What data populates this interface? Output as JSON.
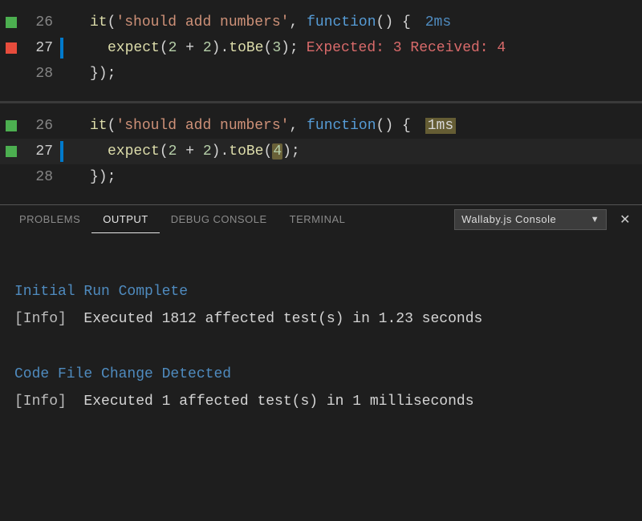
{
  "editors": [
    {
      "lines": [
        {
          "num": "26",
          "marker": "green",
          "cursor": false,
          "current": false,
          "indent": 1,
          "tokens": [
            "it",
            "(",
            "'should add numbers'",
            ",",
            " ",
            "function",
            "()",
            " ",
            "{"
          ],
          "inline_time": "2ms",
          "time_style": "plain"
        },
        {
          "num": "27",
          "marker": "red",
          "cursor": true,
          "current": true,
          "indent": 2,
          "tokens": [
            "expect",
            "(",
            "2",
            " + ",
            "2",
            ")",
            ".",
            "toBe",
            "(",
            "3",
            ")",
            ";"
          ],
          "inline_fail": {
            "expected_label": "Expected:",
            "expected": "3",
            "received_label": "Received:",
            "received": "4"
          }
        },
        {
          "num": "28",
          "marker": null,
          "cursor": false,
          "current": false,
          "indent": 1,
          "tokens": [
            "});"
          ]
        }
      ]
    },
    {
      "lines": [
        {
          "num": "26",
          "marker": "green",
          "cursor": false,
          "current": false,
          "indent": 1,
          "tokens": [
            "it",
            "(",
            "'should add numbers'",
            ",",
            " ",
            "function",
            "()",
            " ",
            "{"
          ],
          "inline_time": "1ms",
          "time_style": "boxed"
        },
        {
          "num": "27",
          "marker": "green",
          "cursor": true,
          "current": true,
          "indent": 2,
          "hl": true,
          "tokens": [
            "expect",
            "(",
            "2",
            " + ",
            "2",
            ")",
            ".",
            "toBe",
            "(",
            "HL4",
            ")",
            ";"
          ]
        },
        {
          "num": "28",
          "marker": null,
          "cursor": false,
          "current": false,
          "indent": 1,
          "tokens": [
            "});"
          ]
        }
      ]
    }
  ],
  "panel": {
    "tabs": {
      "problems": "PROBLEMS",
      "output": "OUTPUT",
      "debug": "DEBUG CONSOLE",
      "terminal": "TERMINAL"
    },
    "dropdown": "Wallaby.js Console"
  },
  "output": {
    "h1": "Initial Run Complete",
    "l1_tag": "[Info]",
    "l1_text": "  Executed 1812 affected test(s) in 1.23 seconds",
    "h2": "Code File Change Detected",
    "l2_tag": "[Info]",
    "l2_text": "  Executed 1 affected test(s) in 1 milliseconds"
  }
}
